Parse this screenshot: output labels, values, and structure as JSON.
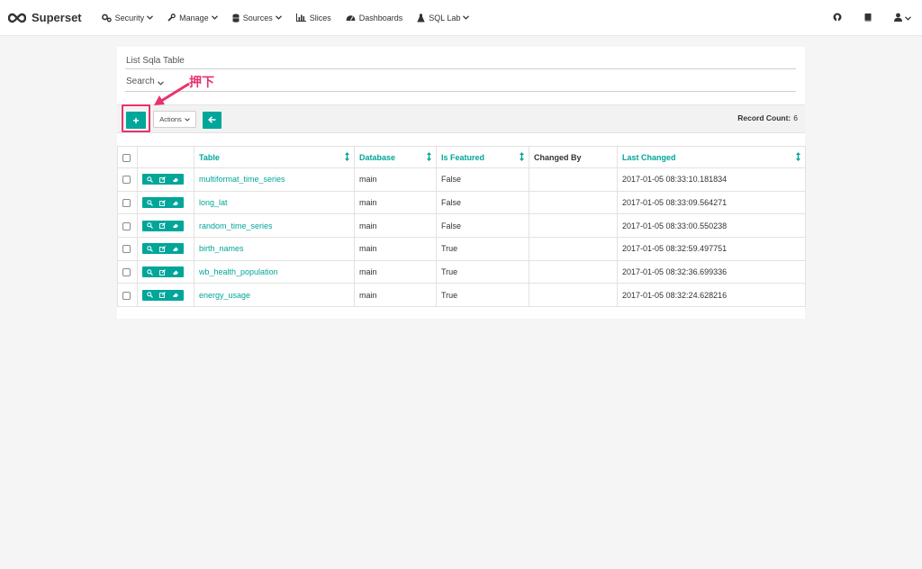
{
  "navbar": {
    "brand": "Superset",
    "items": [
      {
        "label": "Security",
        "icon": "gears-icon",
        "dropdown": true
      },
      {
        "label": "Manage",
        "icon": "wrench-icon",
        "dropdown": true
      },
      {
        "label": "Sources",
        "icon": "database-icon",
        "dropdown": true
      },
      {
        "label": "Slices",
        "icon": "bar-chart-icon",
        "dropdown": false
      },
      {
        "label": "Dashboards",
        "icon": "dashboard-icon",
        "dropdown": false
      },
      {
        "label": "SQL Lab",
        "icon": "flask-icon",
        "dropdown": true
      }
    ],
    "right_icons": [
      "github-icon",
      "book-icon",
      "user-icon"
    ]
  },
  "list": {
    "title": "List Sqla Table",
    "search_label": "Search",
    "actions_label": "Actions",
    "add_label": "+",
    "record_count_label": "Record Count:",
    "record_count": "6",
    "columns": [
      "Table",
      "Database",
      "Is Featured",
      "Changed By",
      "Last Changed"
    ],
    "rows": [
      {
        "table": "multiformat_time_series",
        "database": "main",
        "is_featured": "False",
        "changed_by": "",
        "last_changed": "2017-01-05 08:33:10.181834"
      },
      {
        "table": "long_lat",
        "database": "main",
        "is_featured": "False",
        "changed_by": "",
        "last_changed": "2017-01-05 08:33:09.564271"
      },
      {
        "table": "random_time_series",
        "database": "main",
        "is_featured": "False",
        "changed_by": "",
        "last_changed": "2017-01-05 08:33:00.550238"
      },
      {
        "table": "birth_names",
        "database": "main",
        "is_featured": "True",
        "changed_by": "",
        "last_changed": "2017-01-05 08:32:59.497751"
      },
      {
        "table": "wb_health_population",
        "database": "main",
        "is_featured": "True",
        "changed_by": "",
        "last_changed": "2017-01-05 08:32:36.699336"
      },
      {
        "table": "energy_usage",
        "database": "main",
        "is_featured": "True",
        "changed_by": "",
        "last_changed": "2017-01-05 08:32:24.628216"
      }
    ]
  },
  "annotation": {
    "text": "押下",
    "color": "#e8336b"
  },
  "colors": {
    "accent": "#00a699",
    "annotation": "#e8336b"
  }
}
